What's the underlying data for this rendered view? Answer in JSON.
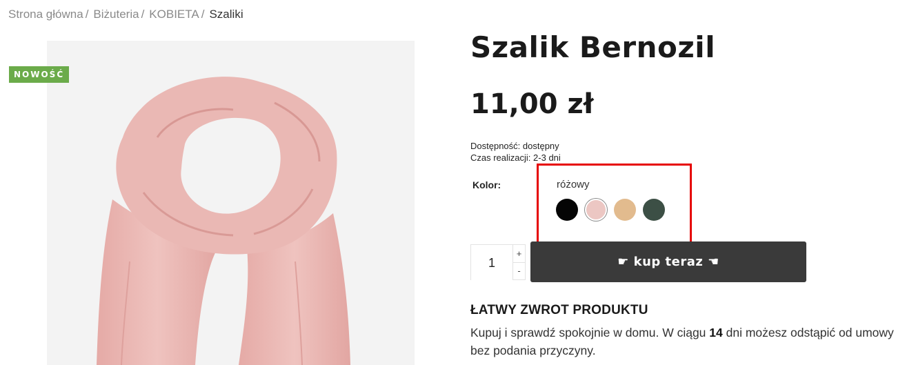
{
  "breadcrumb": {
    "items": [
      "Strona główna",
      "Biżuteria",
      "KOBIETA"
    ],
    "separator": "/",
    "current": "Szaliki"
  },
  "product": {
    "badge": "NOWOŚĆ",
    "title": "Szalik Bernozil",
    "price": "11,00 zł",
    "availability_label": "Dostępność:",
    "availability_value": "dostępny",
    "lead_time_label": "Czas realizacji:",
    "lead_time_value": "2-3 dni"
  },
  "options": {
    "color_label": "Kolor:",
    "selected_color": "różowy",
    "swatches": [
      {
        "name": "czarny",
        "color": "#050505"
      },
      {
        "name": "różowy",
        "color": "#ecc7c3",
        "selected": true
      },
      {
        "name": "beżowy",
        "color": "#e2bb8e"
      },
      {
        "name": "zielony",
        "color": "#3c4f45"
      }
    ]
  },
  "purchase": {
    "quantity": "1",
    "increment": "+",
    "decrement": "-",
    "buy_label": "☛ kup teraz ☚"
  },
  "returns": {
    "title": "ŁATWY ZWROT PRODUKTU",
    "text_before": "Kupuj i sprawdź spokojnie w domu. W ciągu ",
    "days": "14",
    "text_after": " dni możesz odstąpić od umowy bez podania przyczyny."
  },
  "colors": {
    "badge": "#6bab4a",
    "button": "#3a3a3a",
    "highlight": "#e60000",
    "scarf": "#eab8b4"
  }
}
